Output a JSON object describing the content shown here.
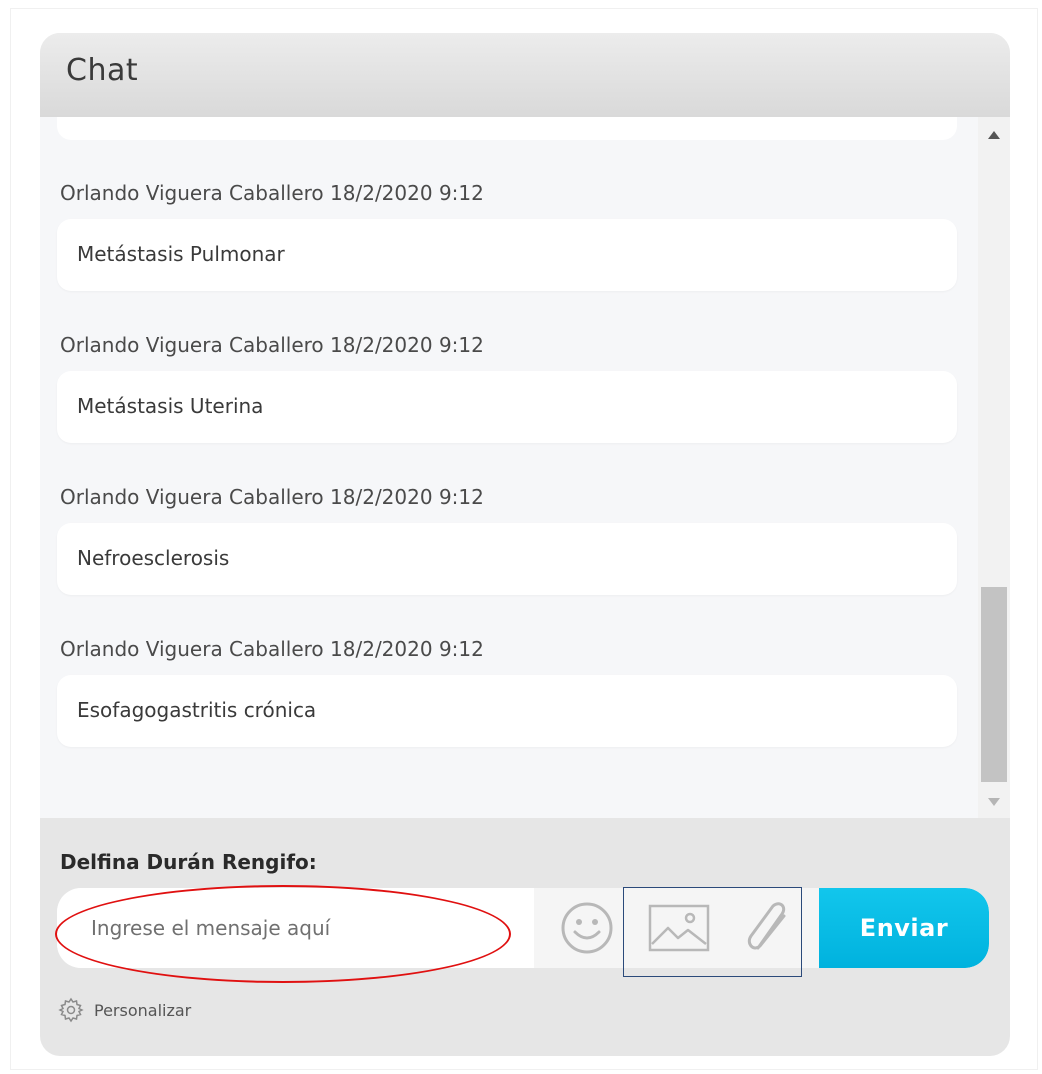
{
  "header": {
    "title": "Chat"
  },
  "messages": [
    {
      "author": "Orlando Viguera Caballero",
      "timestamp": "18/2/2020 9:12",
      "text": "Metástasis Pulmonar"
    },
    {
      "author": "Orlando Viguera Caballero",
      "timestamp": "18/2/2020 9:12",
      "text": "Metástasis Uterina"
    },
    {
      "author": "Orlando Viguera Caballero",
      "timestamp": "18/2/2020 9:12",
      "text": "Nefroesclerosis"
    },
    {
      "author": "Orlando Viguera Caballero",
      "timestamp": "18/2/2020 9:12",
      "text": "Esofagogastritis crónica"
    }
  ],
  "composer": {
    "user_label": "Delfina Durán Rengifo:",
    "placeholder": "Ingrese el mensaje aquí",
    "send_label": "Enviar",
    "icons": [
      "emoji-icon",
      "image-icon",
      "attachment-icon"
    ]
  },
  "footer": {
    "personalize_label": "Personalizar",
    "icon": "gear-icon"
  },
  "colors": {
    "send_button": "#00b8e4",
    "annotation_ellipse": "#e01010",
    "annotation_rect": "#2b4a7a"
  }
}
